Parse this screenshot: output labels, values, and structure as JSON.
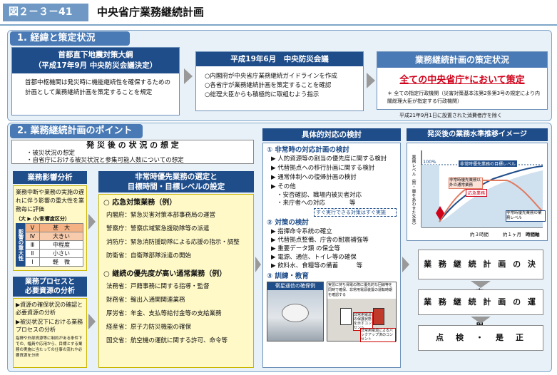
{
  "header": {
    "fig_label": "図２－３－41",
    "title": "中央省庁業務継続計画"
  },
  "s1": {
    "label": "1. 経緯と策定状況",
    "b1": {
      "title_l1": "首都直下地震対策大綱",
      "title_l2": "（平成17年9月 中央防災会議決定）",
      "body": "首都中枢機関は発災時に機能継続性を確保するための計画として業務継続計画を策定することを規定"
    },
    "b2": {
      "title": "平成19年6月　中央防災会議",
      "items": [
        "○内閣府が中央省庁業務継続ガイドラインを作成",
        "○各省庁が業務継続計画を策定することを確認",
        "○総理大臣からも積極的に取組むよう指示"
      ]
    },
    "b3": {
      "title": "業務継続計画の策定状況",
      "highlight": "全ての中央省庁*において策定",
      "note": "＊ 全ての指定行政機関（災害対策基本法第2条第3号の規定により内閣総理大臣が指定する行政機関）",
      "footnote": "平成21年9月1日に設置された消費者庁を除く"
    }
  },
  "s2": {
    "label": "2. 業務継続計画のポイント",
    "assume": {
      "title": "発 災 後 の 状 況 の 想 定",
      "items": [
        "・被災状況の想定",
        "・自省庁における被災状況と参集可能人数についての想定"
      ]
    },
    "impact": {
      "title": "業務影響分析",
      "body": "業務中断や業務の実施の遅れに伴う影響の重大性を業務毎に評価",
      "table_title": "（大 ▶ 小/影響度区分）",
      "side": "影響の重大性",
      "levels": [
        {
          "n": "Ⅴ",
          "l": "甚　大"
        },
        {
          "n": "Ⅳ",
          "l": "大きい"
        },
        {
          "n": "Ⅲ",
          "l": "中程度"
        },
        {
          "n": "Ⅱ",
          "l": "小さい"
        },
        {
          "n": "Ⅰ",
          "l": "軽　微"
        }
      ]
    },
    "process": {
      "title_l1": "業務プロセスと",
      "title_l2": "必要資源の分析",
      "items": [
        "▶資源の確保状況の確認と必要資源の分析",
        "▶被災状況下における業務プロセスの分析"
      ],
      "note": "指揮や外部資源等に制約がある条件下での、幅員や応用から、目標とする業務の実施に当たっての仕事の流れや必要資源を分析"
    },
    "select": {
      "title_l1": "非常時優先業務の選定と",
      "title_l2": "目標時間・目標レベルの設定",
      "emerg_title": "○ 応急対策業務（例）",
      "emerg": [
        "内閣府：緊急災害対策本部事務局の運営",
        "警察庁：警察広域緊急援助隊等の派遣",
        "消防庁：緊急消防援助隊による応援の指示・調整",
        "防衛省：自衛隊部隊派遣の開始"
      ],
      "normal_title": "○ 継続の優先度が高い通常業務（例）",
      "normal": [
        "法務省：戸籍事務に関する指導・監督",
        "財務省：輸出入通関関連業務",
        "厚労省：年金、支払等給付金等の支給業務",
        "経産省：原子力防災機能の確保",
        "国交省：航空機の運航に関する許可、命令等"
      ]
    },
    "measures": {
      "title": "具体的対応の検討",
      "a_title": "① 非常時の対応計画の検討",
      "a_items": [
        "▶ 人的資源等の割当の優先度に関する検討",
        "▶ 代替拠点への移行計画に関する検討",
        "▶ 通常体制への復帰計画の検討",
        "▶ その他",
        "・安否確認、職場内被災者対応",
        "・来庁者への対応　　　　等"
      ],
      "a_note": "すぐ実行できる対策はすぐ実施",
      "b_title": "② 対策の検討",
      "b_items": [
        "▶ 指揮命令系統の確立",
        "▶ 代替拠点整備、庁舎の耐震補強等",
        "▶ 重要データ類 の保全等",
        "▶ 電源、通信、トイレ等の確保",
        "▶ 飲料水、食糧等の備蓄　　　等"
      ],
      "c_title": "③ 訓練・教育",
      "photo1": "衛星通信の確保例",
      "photo2_note": "実習に持ち帰電の際に優先的な回線等を同時で確保、非常用電源装置の運転時期を確認する",
      "photo2_cap1": "非常用電源の保護状態を示すコンセント",
      "photo2_cap2": "非常用電源によるバックアップ済のコンセント"
    },
    "graph": {
      "title": "発災後の業務水準推移イメージ",
      "ylabel": "業務レベル（質・量をあわせた水準）",
      "l1": "100%",
      "l2": "非常時優先業務の目標レベル",
      "l3": "応急業務",
      "l4": "非常時優先業務以外の通常業務",
      "l5": "非常時優先業務の業務レベル",
      "x1": "約３時間",
      "x2": "約１ヶ月",
      "x3": "時間軸"
    },
    "flow": [
      "業 務 継 続 計 画 の 決 定",
      "業 務 継 続 計 画 の 運 用",
      "点　検　・　是　正"
    ]
  }
}
